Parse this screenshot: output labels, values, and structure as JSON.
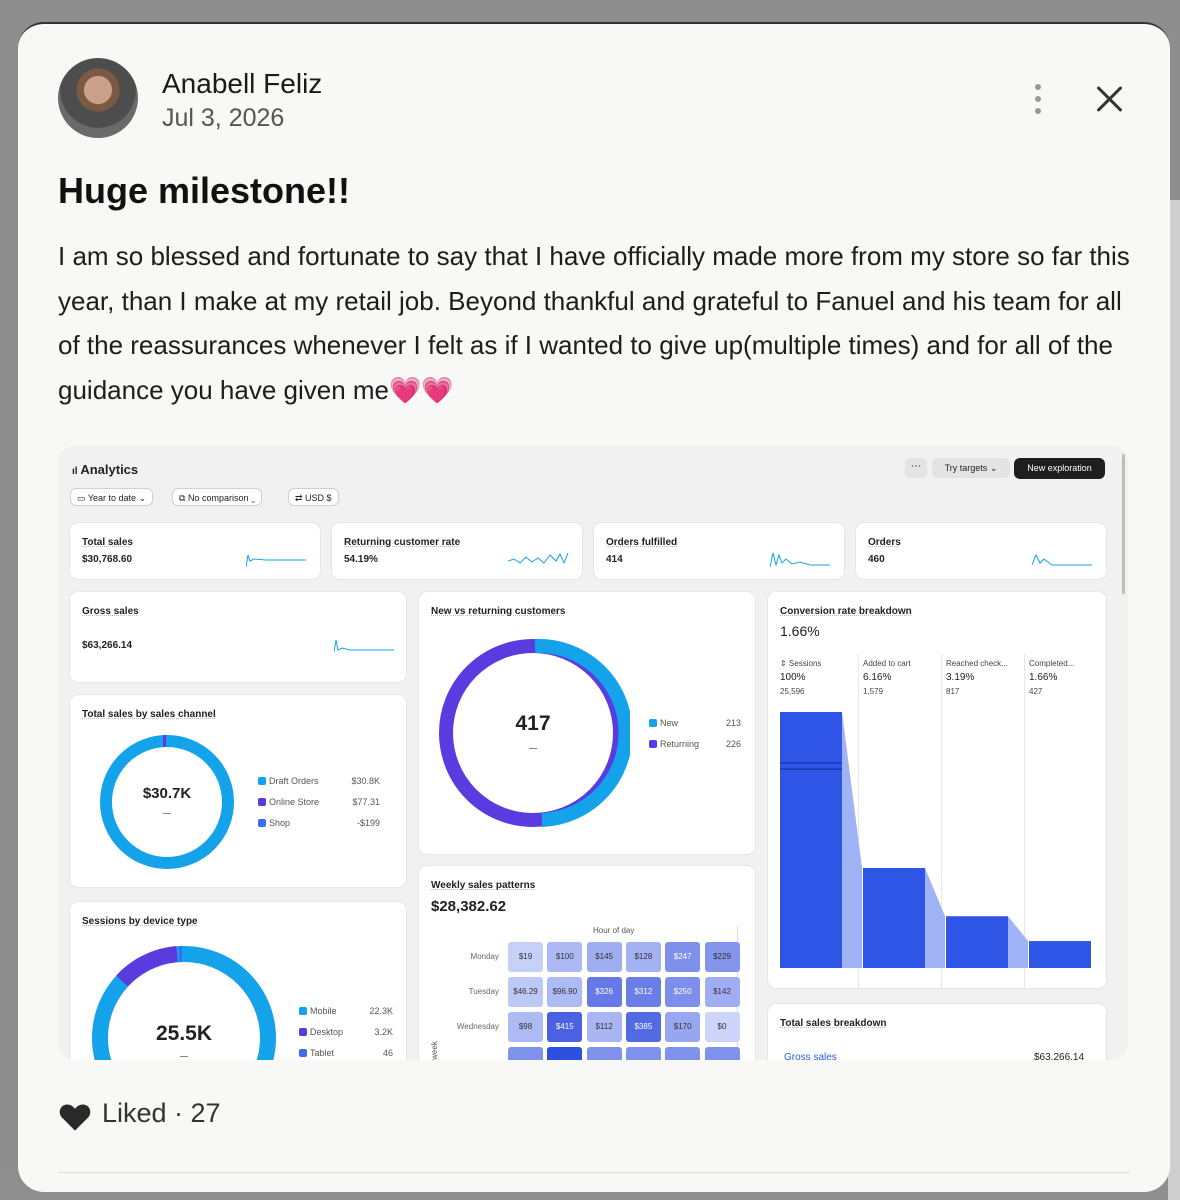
{
  "post": {
    "author": "Anabell Feliz",
    "date": "Jul 3, 2026",
    "title": "Huge milestone!!",
    "body": "I am so blessed and fortunate to say that I have officially made more from my store so far this year, than I make at my retail job. Beyond thankful and grateful to Fanuel and his team for all of the reassurances whenever I felt as if I wanted to give up(multiple times) and for all of the guidance you have given me",
    "emoji": "💗💗",
    "like_label": "Liked · 27"
  },
  "analytics": {
    "title": "Analytics",
    "filters": [
      "Year to date",
      "No comparison",
      "USD $"
    ],
    "buttons": {
      "more": "···",
      "try_targets": "Try targets",
      "new_exploration": "New exploration"
    },
    "kpis": [
      {
        "label": "Total sales",
        "value": "$30,768.60"
      },
      {
        "label": "Returning customer rate",
        "value": "54.19%"
      },
      {
        "label": "Orders fulfilled",
        "value": "414"
      },
      {
        "label": "Orders",
        "value": "460"
      }
    ],
    "gross_sales": {
      "label": "Gross sales",
      "value": "$63,266.14"
    },
    "sales_channel": {
      "title": "Total sales by sales channel",
      "center": "$30.7K",
      "items": [
        {
          "name": "Draft Orders",
          "value": "$30.8K",
          "color": "#14a3ea"
        },
        {
          "name": "Online Store",
          "value": "$77.31",
          "color": "#5a3be0"
        },
        {
          "name": "Shop",
          "value": "-$199",
          "color": "#3b6df0"
        }
      ]
    },
    "device": {
      "title": "Sessions by device type",
      "center": "25.5K",
      "items": [
        {
          "name": "Mobile",
          "value": "22.3K",
          "color": "#14a3ea"
        },
        {
          "name": "Desktop",
          "value": "3.2K",
          "color": "#5a3be0"
        },
        {
          "name": "Tablet",
          "value": "46",
          "color": "#3b6df0"
        }
      ]
    },
    "new_vs_returning": {
      "title": "New vs returning customers",
      "center": "417",
      "items": [
        {
          "name": "New",
          "value": "213",
          "color": "#14a3ea"
        },
        {
          "name": "Returning",
          "value": "226",
          "color": "#5a3be0"
        }
      ]
    },
    "weekly": {
      "title": "Weekly sales patterns",
      "value": "$28,382.62",
      "axis_top": "Hour of day",
      "axis_left": "week",
      "rows": [
        {
          "day": "Monday",
          "cells": [
            "$19",
            "$100",
            "$145",
            "$128",
            "$247",
            "$229"
          ]
        },
        {
          "day": "Tuesday",
          "cells": [
            "$46.29",
            "$96.90",
            "$326",
            "$312",
            "$250",
            "$142"
          ]
        },
        {
          "day": "Wednesday",
          "cells": [
            "$98",
            "$415",
            "$112",
            "$385",
            "$170",
            "$0"
          ]
        }
      ]
    },
    "conversion": {
      "title": "Conversion rate breakdown",
      "value": "1.66%",
      "steps": [
        {
          "name": "Sessions",
          "pct": "100%",
          "count": "25,596"
        },
        {
          "name": "Added to cart",
          "pct": "6.16%",
          "count": "1,579"
        },
        {
          "name": "Reached check...",
          "pct": "3.19%",
          "count": "817"
        },
        {
          "name": "Completed...",
          "pct": "1.66%",
          "count": "427"
        }
      ]
    },
    "breakdown": {
      "title": "Total sales breakdown",
      "row_label": "Gross sales",
      "row_value": "$63,266.14"
    }
  }
}
